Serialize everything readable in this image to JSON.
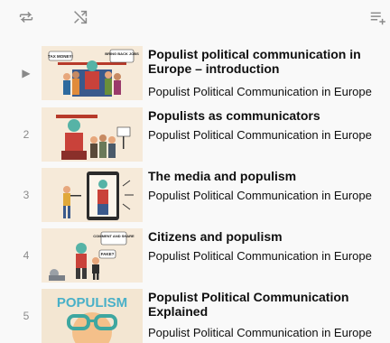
{
  "toolbar": {
    "loop_icon": "repeat-icon",
    "shuffle_icon": "shuffle-icon",
    "save_icon": "add-to-playlist-icon"
  },
  "playlist": {
    "items": [
      {
        "index": "▶",
        "title": "Populist political communication in Europe – introduction",
        "channel": "Populist Political Communication in Europe"
      },
      {
        "index": "2",
        "title": "Populists as communicators",
        "channel": "Populist Political Communication in Europe"
      },
      {
        "index": "3",
        "title": "The media and populism",
        "channel": "Populist Political Communication in Europe"
      },
      {
        "index": "4",
        "title": "Citizens and populism",
        "channel": "Populist Political Communication in Europe"
      },
      {
        "index": "5",
        "title": "Populist Political Communication Explained",
        "channel": "Populist Political Communication in Europe"
      }
    ]
  },
  "thumbnails": {
    "t1": {
      "bubble_left": "TAX MONEY!",
      "bubble_right": "BRING BACK JOBS"
    },
    "t4": {
      "bubble_top": "COMMENT AND SHARE",
      "bubble_side": "FAKE?"
    },
    "t5": {
      "banner": "POPULISM"
    }
  },
  "colors": {
    "background": "#f9f9f9",
    "text": "#0f0f0f",
    "muted": "#8a8a8a",
    "thumb_bg": "#f6ead9"
  }
}
